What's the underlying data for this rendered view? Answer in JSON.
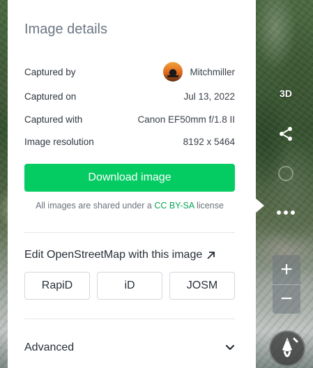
{
  "panel": {
    "title": "Image details",
    "details": [
      {
        "label": "Captured by",
        "value": "Mitchmiller"
      },
      {
        "label": "Captured on",
        "value": "Jul 13, 2022"
      },
      {
        "label": "Captured with",
        "value": "Canon EF50mm f/1.8 II"
      },
      {
        "label": "Image resolution",
        "value": "8192 x 5464"
      }
    ],
    "download_label": "Download image",
    "license_prefix": "All images are shared under a",
    "license_link": "CC BY-SA",
    "license_suffix": "license",
    "edit_heading": "Edit OpenStreetMap with this image",
    "editors": [
      "RapiD",
      "iD",
      "JOSM"
    ],
    "advanced_label": "Advanced"
  },
  "controls": {
    "mode_3d": "3D",
    "zoom_in": "+",
    "zoom_out": "−"
  },
  "colors": {
    "accent": "#05cb63",
    "link": "#05a352"
  }
}
